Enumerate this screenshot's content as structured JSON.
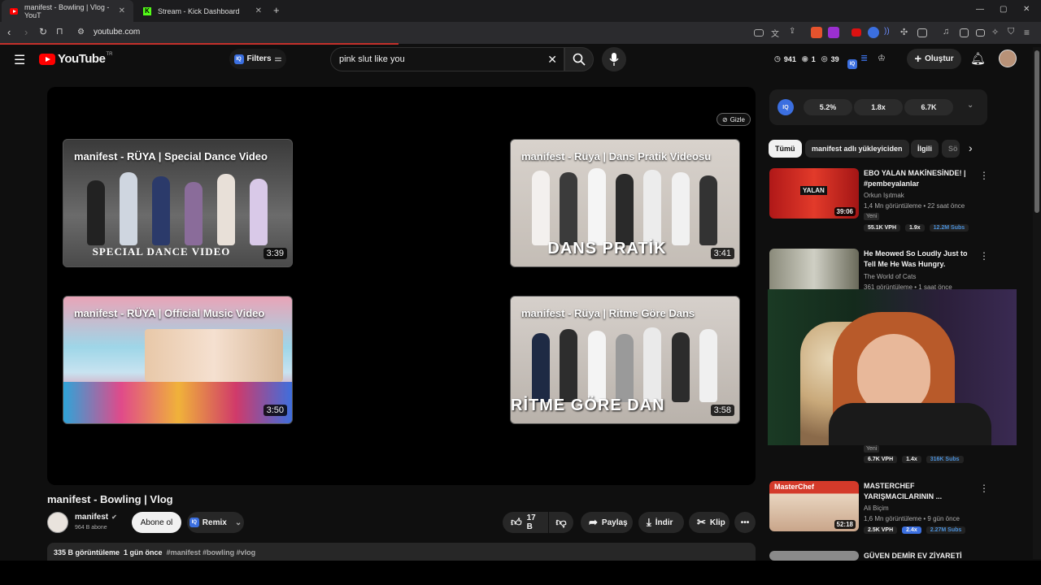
{
  "browser": {
    "tabs": [
      {
        "title": "manifest - Bowling | Vlog - YouT",
        "active": true
      },
      {
        "title": "Stream - Kick Dashboard",
        "active": false
      }
    ],
    "new_tab": "+",
    "url": "youtube.com",
    "window_controls": [
      "—",
      "▢",
      "✕"
    ]
  },
  "youtube": {
    "logo_text": "YouTube",
    "logo_region": "TR",
    "filters_label": "Filters",
    "search_value": "pink slut like you",
    "header_stats": {
      "a": "941",
      "b": "1",
      "c": "39"
    },
    "create_label": "Oluştur"
  },
  "player": {
    "hide_label": "Gizle",
    "endcards": [
      {
        "title": "manifest - RÜYA | Special Dance Video",
        "duration": "3:39",
        "overlay": "SPECIAL DANCE VIDEO"
      },
      {
        "title": "manifest - Rüya | Dans Pratik Videosu",
        "duration": "3:41",
        "overlay": "DANS PRATİK"
      },
      {
        "title": "manifest - RÜYA | Official Music Video",
        "duration": "3:50",
        "overlay": ""
      },
      {
        "title": "manifest - Rüya | Ritme Göre Dans",
        "duration": "3:58",
        "overlay": "RİTME GÖRE DAN"
      }
    ]
  },
  "video": {
    "title": "manifest - Bowling | Vlog",
    "channel": "manifest",
    "subscribers": "964 B abone",
    "subscribe_label": "Abone ol",
    "remix_label": "Remix",
    "likes": "17 B",
    "share_label": "Paylaş",
    "download_label": "İndir",
    "clip_label": "Klip",
    "views": "335 B görüntüleme",
    "published": "1 gün önce",
    "hashtags": "#manifest #bowling #vlog"
  },
  "sidebar": {
    "iq_stats": [
      "5.2%",
      "1.8x",
      "6.7K"
    ],
    "chips": [
      "Tümü",
      "manifest adlı yükleyiciden",
      "İlgili",
      "Sö"
    ],
    "recs": [
      {
        "title": "EBO YALAN MAKİNESİNDE! | #pembeyalanlar",
        "channel": "Orkun Işıtmak",
        "meta": "1,4 Mn görüntüleme • 22 saat önce",
        "new": "Yeni",
        "duration": "39:06",
        "thumb_text": "YALAN",
        "vph": "55.1K VPH",
        "mult": "1.9x",
        "subs": "12.2M Subs"
      },
      {
        "title": "He Meowed So Loudly Just to Tell Me He Was Hungry.",
        "channel": "The World of Cats",
        "meta": "361 görüntüleme • 1 saat önce"
      },
      {
        "new": "Yeni",
        "vph": "6.7K VPH",
        "mult": "1.4x",
        "subs": "316K Subs"
      },
      {
        "title": "MASTERCHEF YARIŞMACILARININ ...",
        "channel": "Ali Biçim",
        "meta": "1,6 Mn görüntüleme • 9 gün önce",
        "duration": "52:18",
        "thumb_text": "MasterChef",
        "vph": "2.5K VPH",
        "mult": "2.4x",
        "subs": "2.27M Subs"
      },
      {
        "title": "GÜVEN DEMİR EV ZİYARETİ"
      }
    ]
  },
  "colors": {
    "accent": "#ff0000",
    "iq_blue": "#3b6fe0",
    "subs_blue": "#4a90d9"
  }
}
